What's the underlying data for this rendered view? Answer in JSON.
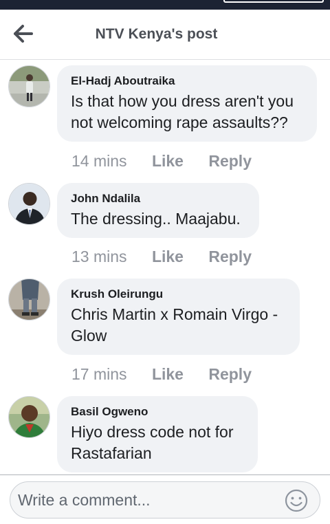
{
  "header": {
    "title": "NTV Kenya's post",
    "back_icon": "arrow-left-icon"
  },
  "comments": [
    {
      "author": "El-Hadj Aboutraika",
      "text": "Is that how you dress aren't you not welcoming rape assaults??",
      "time": "14 mins",
      "like_label": "Like",
      "reply_label": "Reply"
    },
    {
      "author": "John Ndalila",
      "text": "The dressing.. Maajabu.",
      "time": "13 mins",
      "like_label": "Like",
      "reply_label": "Reply"
    },
    {
      "author": "Krush Oleirungu",
      "text": "Chris Martin x Romain Virgo - Glow",
      "time": "17 mins",
      "like_label": "Like",
      "reply_label": "Reply"
    },
    {
      "author": "Basil Ogweno",
      "text": "Hiyo dress code not for Rastafarian"
    }
  ],
  "composer": {
    "placeholder": "Write a comment...",
    "emoji_icon": "smiley-icon"
  },
  "colors": {
    "bubble": "#f0f2f5",
    "muted_text": "#90949c",
    "title_text": "#4b4f56",
    "status_bar": "#1c2333"
  }
}
